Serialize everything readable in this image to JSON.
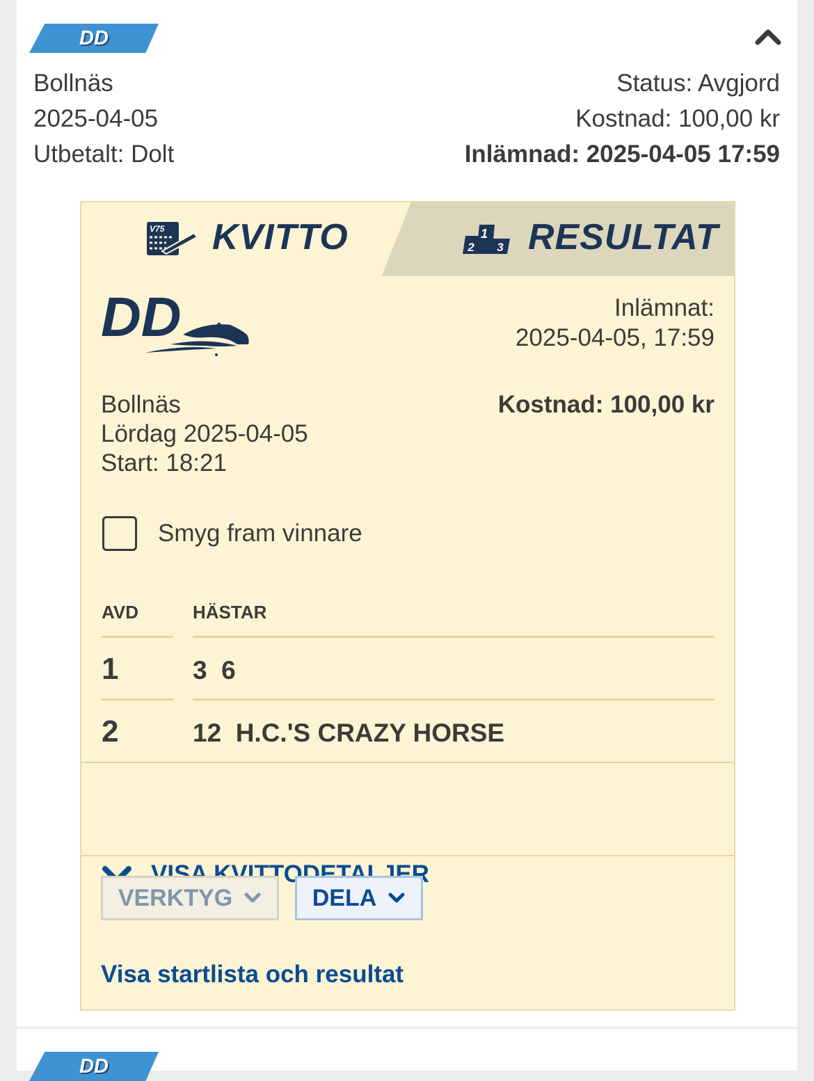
{
  "ticket": {
    "game_badge": "DD",
    "track": "Bollnäs",
    "date": "2025-04-05",
    "payout": "Utbetalt: Dolt",
    "status": "Status: Avgjord",
    "cost": "Kostnad: 100,00 kr",
    "submitted": "Inlämnad: 2025-04-05 17:59"
  },
  "tabs": {
    "kvitto": "KVITTO",
    "resultat": "RESULTAT",
    "kvitto_icon_text": "V75"
  },
  "receipt": {
    "logo_text": "DD",
    "submitted_label": "Inlämnat:",
    "submitted_value": "2025-04-05, 17:59",
    "track": "Bollnäs",
    "day": "Lördag 2025-04-05",
    "start": "Start: 18:21",
    "cost": "Kostnad: 100,00 kr",
    "sneak_label": "Smyg fram vinnare",
    "table": {
      "headers": [
        "AVD",
        "HÄSTAR"
      ],
      "rows": [
        {
          "avd": "1",
          "horses": "3  6"
        },
        {
          "avd": "2",
          "horses": "12  H.C.'S CRAZY HORSE"
        }
      ]
    },
    "show_details": "VISA KVITTODETALJER",
    "tools_button": "VERKTYG",
    "share_button": "DELA",
    "startlist_link": "Visa startlista och resultat"
  },
  "next_ticket": {
    "game_badge": "DD"
  },
  "colors": {
    "badge": "#3f93d2",
    "receipt_bg": "#fdf4d3",
    "tab_inactive": "#dcd7bc",
    "navy": "#1c3556",
    "link": "#0a4c92"
  },
  "icons": [
    "chevron-up-icon",
    "receipt-icon",
    "podium-icon",
    "chevron-down-icon"
  ]
}
